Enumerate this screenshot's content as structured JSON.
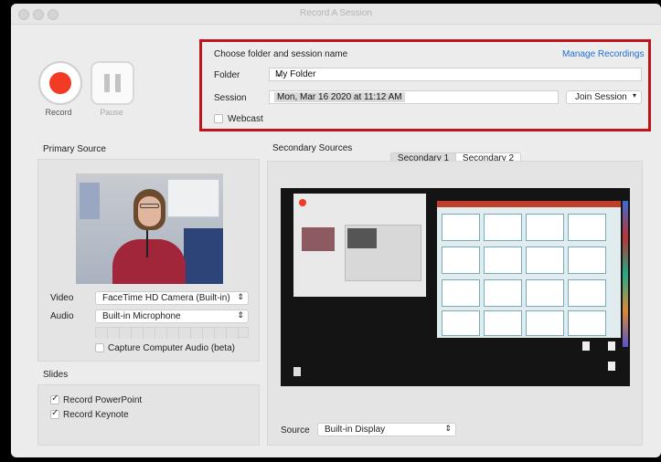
{
  "window": {
    "title": "Record A Session"
  },
  "controls": {
    "record_label": "Record",
    "pause_label": "Pause"
  },
  "session": {
    "heading": "Choose folder and session name",
    "manage_link": "Manage Recordings",
    "folder_label": "Folder",
    "folder_value": "My Folder",
    "session_label": "Session",
    "session_value": "Mon, Mar 16 2020 at 11:12 AM",
    "join_label": "Join Session",
    "webcast_label": "Webcast"
  },
  "primary": {
    "title": "Primary Source",
    "video_label": "Video",
    "video_value": "FaceTime HD Camera (Built-in)",
    "audio_label": "Audio",
    "audio_value": "Built-in Microphone",
    "capture_label": "Capture Computer Audio (beta)"
  },
  "slides": {
    "title": "Slides",
    "items": [
      "Record PowerPoint",
      "Record Keynote"
    ]
  },
  "secondary": {
    "title": "Secondary Sources",
    "tabs": [
      "Secondary 1",
      "Secondary 2"
    ],
    "source_label": "Source",
    "source_value": "Built-in Display"
  },
  "colors": {
    "accent": "#1f6fd6",
    "record": "#f23a24",
    "highlight": "#c0141c"
  }
}
